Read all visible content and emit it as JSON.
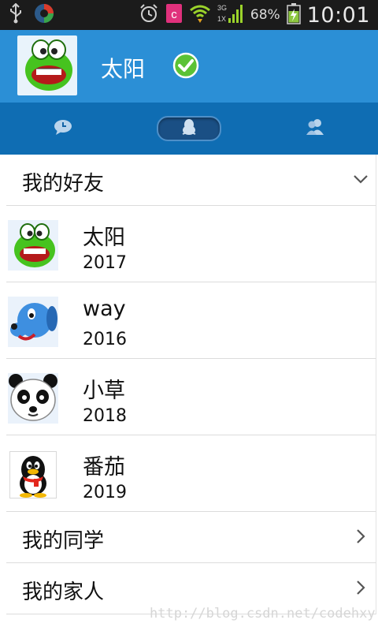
{
  "status_bar": {
    "battery_percent": "68%",
    "time": "10:01",
    "network_labels": [
      "3G",
      "1X"
    ],
    "icons": [
      "usb-icon",
      "app-icon",
      "alarm-icon",
      "app-c-icon",
      "wifi-icon",
      "signal-icon",
      "battery-charging-icon"
    ]
  },
  "header": {
    "username": "太阳",
    "status": "online-check-icon"
  },
  "tabs": [
    {
      "name": "messages",
      "icon": "chat-bubble-icon",
      "selected": false
    },
    {
      "name": "contacts",
      "icon": "penguin-icon",
      "selected": true
    },
    {
      "name": "groups",
      "icon": "people-icon",
      "selected": false
    }
  ],
  "groups": [
    {
      "label": "我的好友",
      "expanded": true,
      "friends": [
        {
          "name": "太阳",
          "signature": "2017",
          "avatar": "green-frog-avatar"
        },
        {
          "name": "way",
          "signature": "2016",
          "avatar": "blue-dog-avatar"
        },
        {
          "name": "小草",
          "signature": "2018",
          "avatar": "panda-avatar"
        },
        {
          "name": "番茄",
          "signature": "2019",
          "avatar": "penguin-avatar"
        }
      ]
    },
    {
      "label": "我的同学",
      "expanded": false,
      "friends": []
    },
    {
      "label": "我的家人",
      "expanded": false,
      "friends": []
    }
  ],
  "watermark": "http://blog.csdn.net/codehxy",
  "colors": {
    "header": "#2b8fd6",
    "tabbar": "#0f6db3",
    "statusbar": "#1b1b1b"
  }
}
